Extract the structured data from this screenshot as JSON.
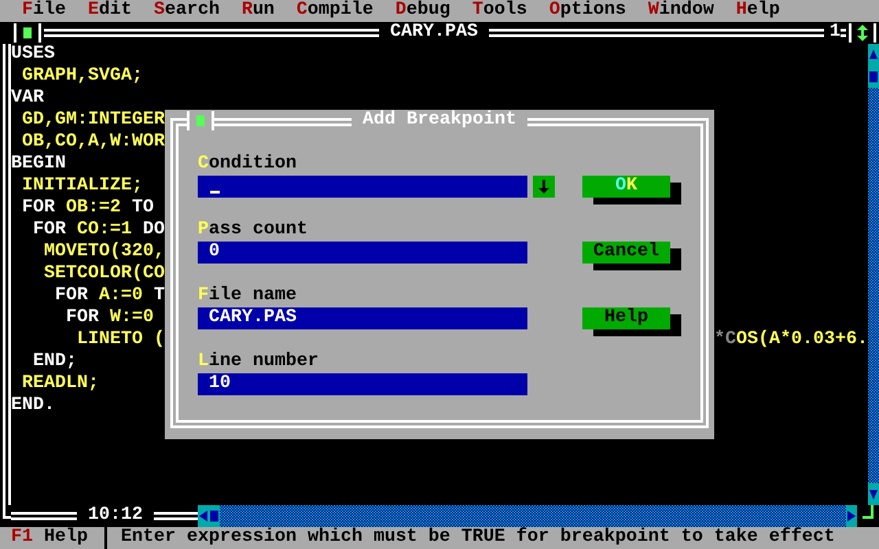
{
  "menu": [
    {
      "hotkey": "F",
      "rest": "ile"
    },
    {
      "hotkey": "E",
      "rest": "dit"
    },
    {
      "hotkey": "S",
      "rest": "earch"
    },
    {
      "hotkey": "R",
      "rest": "un"
    },
    {
      "hotkey": "C",
      "rest": "ompile"
    },
    {
      "hotkey": "D",
      "rest": "ebug"
    },
    {
      "hotkey": "T",
      "rest": "ools"
    },
    {
      "hotkey": "O",
      "rest": "ptions"
    },
    {
      "hotkey": "W",
      "rest": "indow"
    },
    {
      "hotkey": "H",
      "rest": "elp"
    }
  ],
  "editor": {
    "title": "CARY.PAS",
    "window_number": "1",
    "position": "10:12",
    "lines": [
      {
        "segments": [
          {
            "kind": "reserved",
            "text": "USES"
          }
        ]
      },
      {
        "segments": [
          {
            "kind": "plain",
            "text": " GRAPH,SVGA;"
          }
        ]
      },
      {
        "segments": [
          {
            "kind": "reserved",
            "text": "VAR"
          }
        ]
      },
      {
        "segments": [
          {
            "kind": "plain",
            "text": " GD,GM:INTEGER"
          }
        ]
      },
      {
        "segments": [
          {
            "kind": "plain",
            "text": " OB,CO,A,W:WOR"
          }
        ]
      },
      {
        "segments": [
          {
            "kind": "reserved",
            "text": "BEGIN"
          }
        ]
      },
      {
        "segments": [
          {
            "kind": "plain",
            "text": " INITIALIZE;"
          }
        ]
      },
      {
        "segments": [
          {
            "kind": "reserved",
            "text": " FOR"
          },
          {
            "kind": "plain",
            "text": " OB:=2"
          },
          {
            "kind": "reserved",
            "text": " TO"
          }
        ]
      },
      {
        "segments": [
          {
            "kind": "reserved",
            "text": "  FOR"
          },
          {
            "kind": "plain",
            "text": " CO:=1"
          },
          {
            "kind": "reserved",
            "text": " DO"
          }
        ]
      },
      {
        "segments": [
          {
            "kind": "plain",
            "text": "   MOVETO(320,"
          }
        ]
      },
      {
        "segments": [
          {
            "kind": "plain",
            "text": "   SETCOLOR(CO"
          }
        ]
      },
      {
        "segments": [
          {
            "kind": "reserved",
            "text": "    FOR"
          },
          {
            "kind": "plain",
            "text": " A:=0"
          },
          {
            "kind": "reserved",
            "text": " T"
          }
        ]
      },
      {
        "segments": [
          {
            "kind": "reserved",
            "text": "     FOR"
          },
          {
            "kind": "plain",
            "text": " W:=0"
          }
        ]
      },
      {
        "segments": [
          {
            "kind": "plain",
            "text": "      LINETO ("
          }
        ],
        "tail": "*COS(A*0.03+6."
      },
      {
        "segments": [
          {
            "kind": "reserved",
            "text": "  END;"
          }
        ]
      },
      {
        "segments": [
          {
            "kind": "plain",
            "text": " READLN;"
          }
        ]
      },
      {
        "segments": [
          {
            "kind": "reserved",
            "text": "END."
          }
        ]
      }
    ]
  },
  "dialog": {
    "title": "Add Breakpoint",
    "fields": [
      {
        "hotkey": "C",
        "rest": "ondition",
        "kind": "combo",
        "focused": true
      },
      {
        "hotkey": "P",
        "rest": "ass count",
        "kind": "text",
        "focused": false,
        "value": "0"
      },
      {
        "hotkey": "F",
        "rest": "ile name",
        "kind": "text",
        "focused": false,
        "value": "CARY.PAS"
      },
      {
        "hotkey": "L",
        "rest": "ine number",
        "kind": "text",
        "focused": false,
        "value": "10"
      }
    ],
    "buttons": [
      {
        "hotkey": "O",
        "rest": "K",
        "default": true
      },
      {
        "rest": "Cancel",
        "default": false
      },
      {
        "rest": "Help",
        "default": false
      }
    ]
  },
  "status_bar": {
    "key": "F1",
    "label": "Help",
    "message": "Enter expression which must be TRUE for breakpoint to take effect"
  }
}
